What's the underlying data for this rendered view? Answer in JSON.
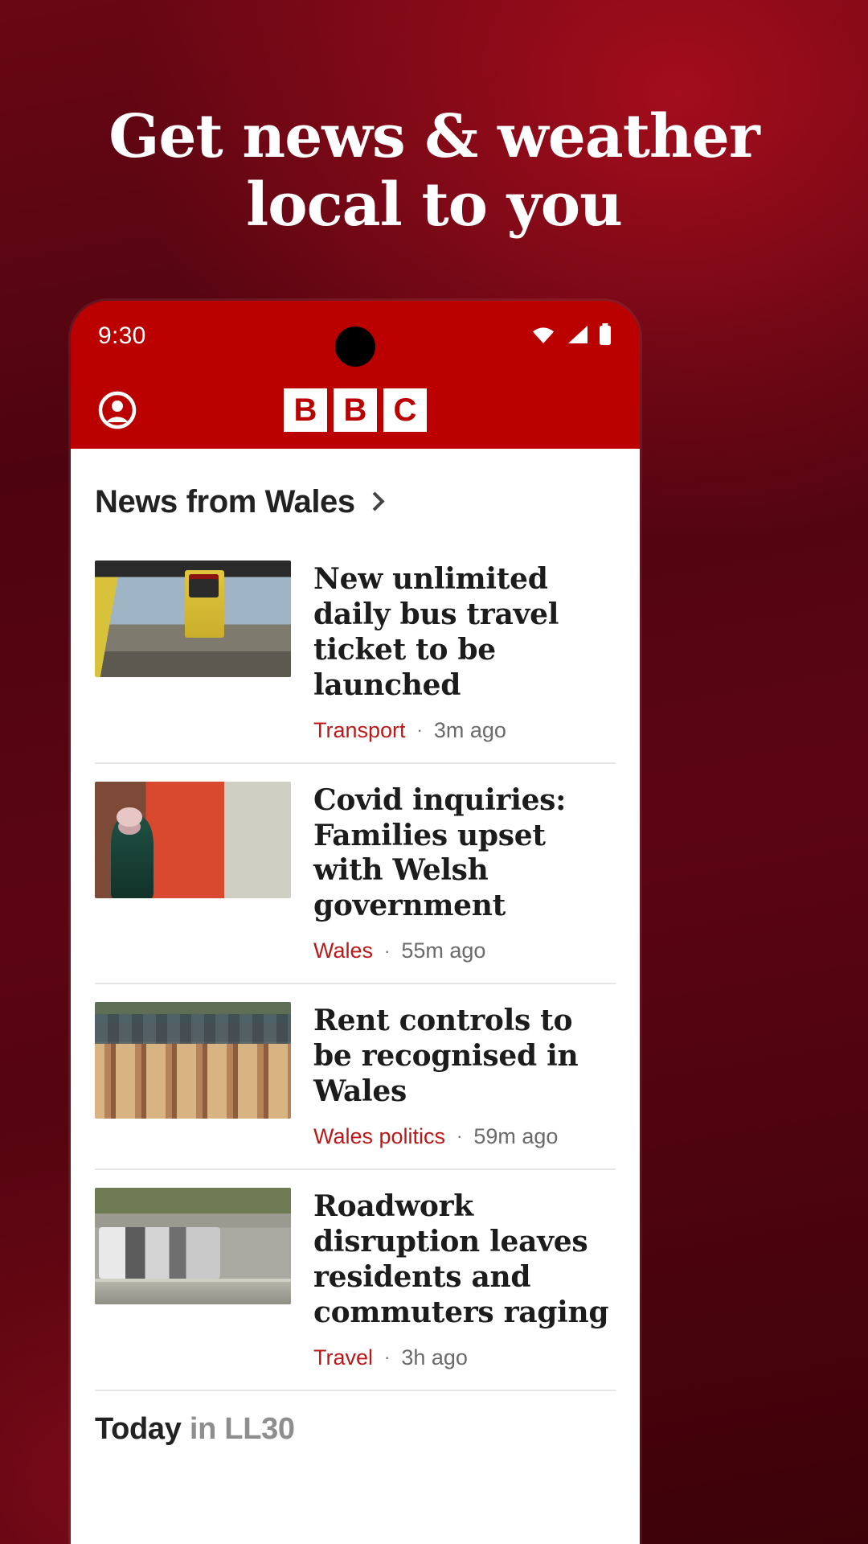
{
  "promo": {
    "line1": "Get news & weather",
    "line2": "local to you"
  },
  "colors": {
    "bbc_red": "#bb0000",
    "category_red": "#bb1919",
    "backdrop_dark_red": "#5e0512",
    "meta_gray": "#6a6a6a"
  },
  "phone": {
    "status_bar": {
      "clock": "9:30",
      "icons": [
        "wifi-icon",
        "signal-icon",
        "battery-icon"
      ]
    },
    "app_bar": {
      "profile_icon": "account-circle-icon",
      "logo_blocks": [
        "B",
        "B",
        "C"
      ]
    }
  },
  "section": {
    "title": "News from Wales",
    "chevron_icon": "chevron-right-icon"
  },
  "articles": [
    {
      "headline": "New unlimited daily bus travel ticket to be launched",
      "category": "Transport",
      "separator": "·",
      "time": "3m ago",
      "thumb_name": "bus-interior-photo"
    },
    {
      "headline": "Covid inquiries: Families upset with Welsh government",
      "category": "Wales",
      "separator": "·",
      "time": "55m ago",
      "thumb_name": "covid-sign-photo"
    },
    {
      "headline": "Rent controls to be recognised in Wales",
      "category": "Wales politics",
      "separator": "·",
      "time": "59m ago",
      "thumb_name": "terraced-houses-photo"
    },
    {
      "headline": "Roadwork disruption leaves residents and commuters raging",
      "category": "Travel",
      "separator": "·",
      "time": "3h ago",
      "thumb_name": "traffic-queue-photo"
    }
  ],
  "today_strip": {
    "bold_part": "Today",
    "rest_part": " in LL30"
  }
}
